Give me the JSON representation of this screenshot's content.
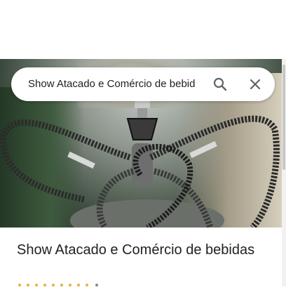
{
  "search": {
    "value": "Show Atacado e Comércio de bebid"
  },
  "place": {
    "name": "Show Atacado e Comércio de bebidas"
  },
  "icons": {
    "search": "search-icon",
    "close": "close-icon"
  },
  "colors": {
    "text": "#202124",
    "icon": "#5f6368",
    "background": "#ffffff"
  }
}
